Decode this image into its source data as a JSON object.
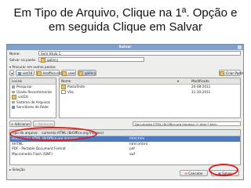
{
  "instruction": {
    "line1": "Em Tipo de Arquivo, Clique na 1ª. Opção e",
    "line2": "em seguida Clique em Salvar"
  },
  "dialog": {
    "title": "Salvar",
    "name_label": "Nome:",
    "name_value": "Sem título 1",
    "folder_label": "Salvar na pasta:",
    "folder_value": "gallery",
    "browse_label": "Procurar em outras pastas",
    "path": [
      "vist16",
      "broffice.org",
      "user",
      "gallery"
    ],
    "create_folder": "Criar Pasta",
    "places": {
      "header": "Locais",
      "items": [
        {
          "name": "Pesquisar",
          "icon": "search-icon"
        },
        {
          "name": "Usado Recentemente",
          "icon": "recent-icon"
        },
        {
          "name": "vist16",
          "icon": "home-folder-icon"
        },
        {
          "name": "Sistema de Arquivos",
          "icon": "drive-icon"
        },
        {
          "name": "Servidores de Rede",
          "icon": "network-icon"
        }
      ],
      "add": "Adicionar",
      "remove": "Remover"
    },
    "files": {
      "col_name": "Nome",
      "col_modified": "Modificado",
      "rows": [
        {
          "name": "PastaTeste",
          "modified": "20-08-2011"
        },
        {
          "name": "Vila",
          "modified": "11-10-2011"
        }
      ]
    },
    "filter_value": "Documento HTML (BrOffice.org Impress) (*.html;*.htm)",
    "type_label": "Tipo de arquivo:",
    "type_col1_fragment": "cumento HTML (BrOffice.org Impress)",
    "types": [
      {
        "name": "Documento HTML (BrOffice.org Impress)",
        "ext": "html;htm"
      },
      {
        "name": "XHTML",
        "ext": "html;xhtml"
      },
      {
        "name": "PDF - Portable Document Format",
        "ext": "pdf"
      },
      {
        "name": "Macromedia Flash (SWF)",
        "ext": "swf"
      }
    ],
    "selection_label": "Seleção",
    "cancel": "Cancelar",
    "save": "Salvar"
  },
  "colors": {
    "highlight_ring": "#e21b1b",
    "selection": "#4b79c2",
    "titlebar": "#7ea2cf"
  }
}
